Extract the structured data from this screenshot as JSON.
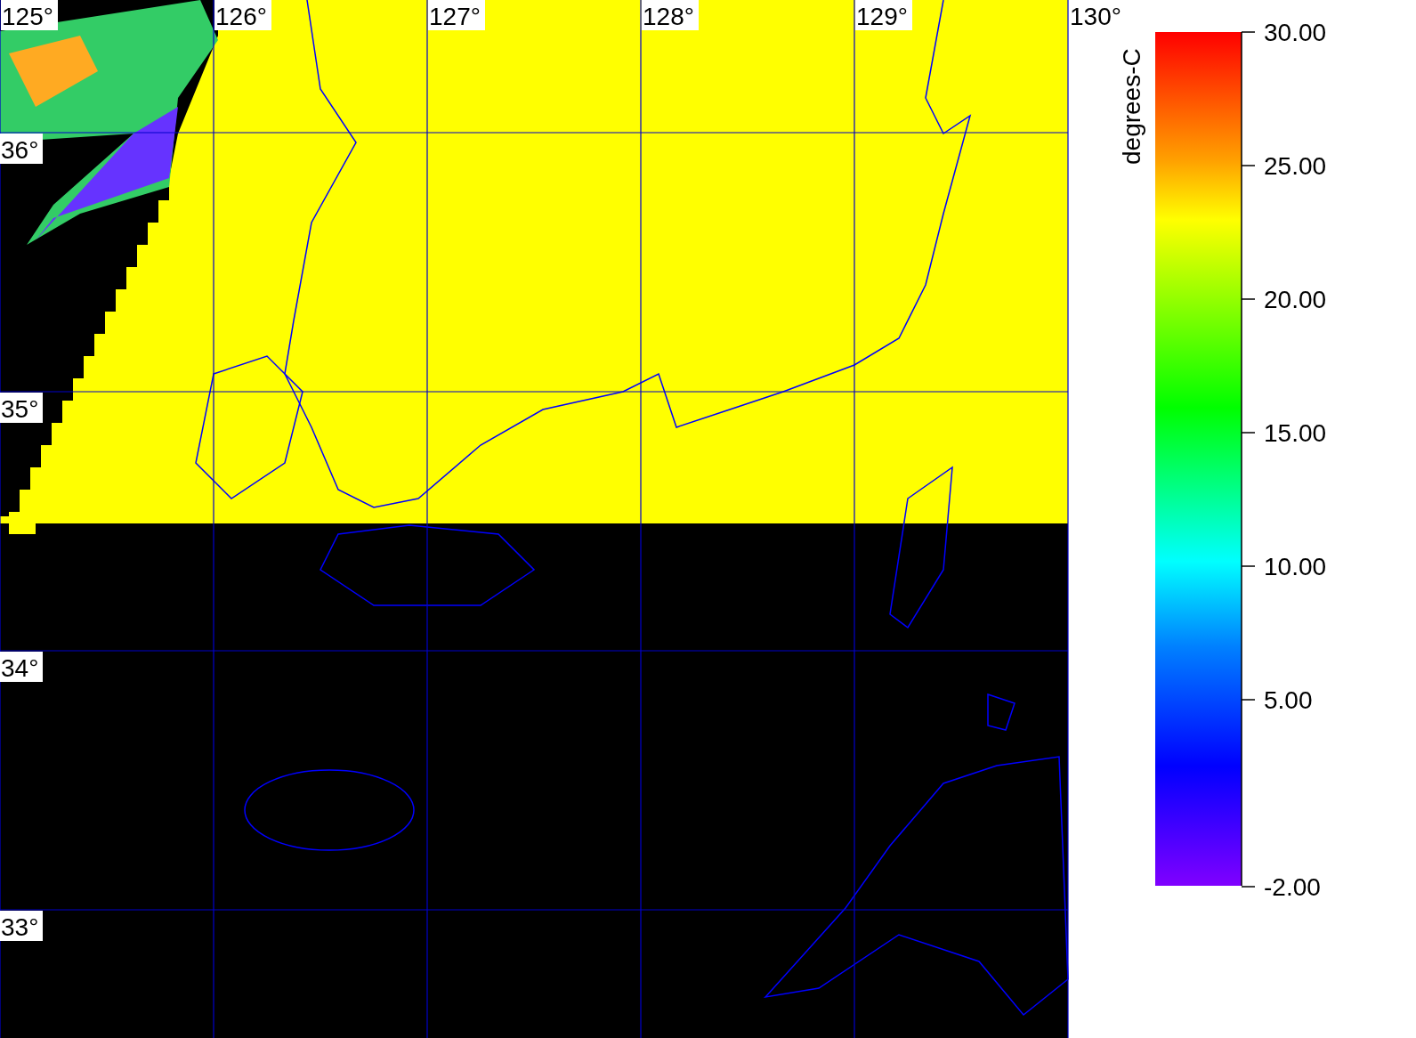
{
  "map": {
    "longitude_labels": [
      "125°",
      "126°",
      "127°",
      "128°",
      "129°",
      "130°"
    ],
    "latitude_labels": [
      "36°",
      "35°",
      "34°",
      "33°"
    ]
  },
  "colorbar": {
    "unit": "degrees-C",
    "tick_labels": [
      "30.00",
      "25.00",
      "20.00",
      "15.00",
      "10.00",
      "5.00",
      "-2.00"
    ]
  }
}
